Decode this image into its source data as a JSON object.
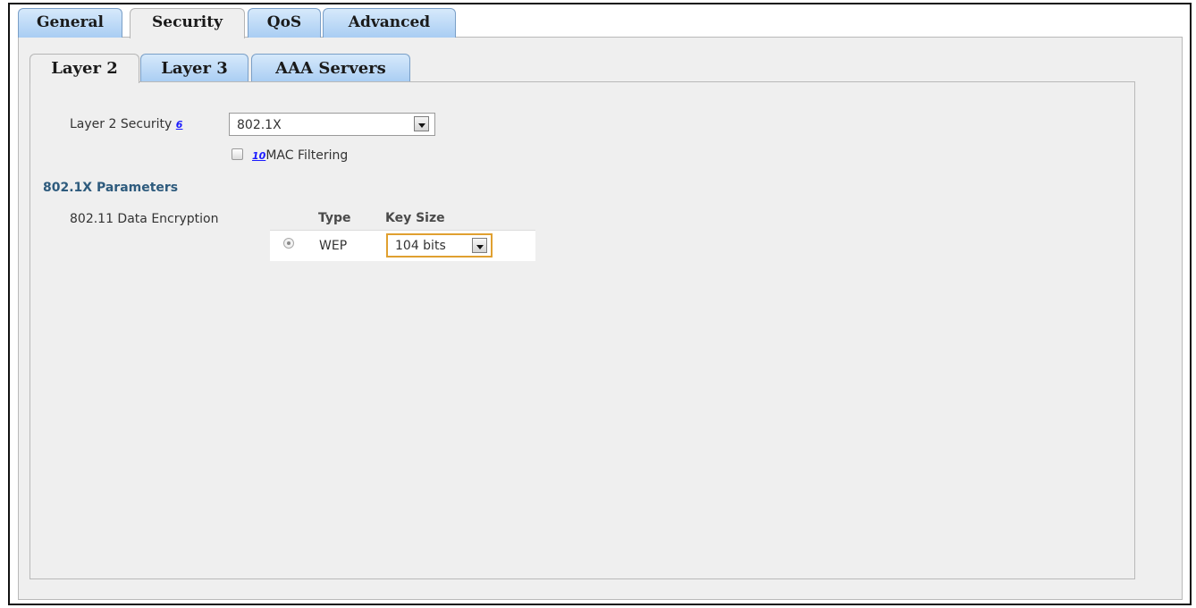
{
  "top_tabs": [
    {
      "label": "General",
      "active": false
    },
    {
      "label": "Security",
      "active": true
    },
    {
      "label": "QoS",
      "active": false
    },
    {
      "label": "Advanced",
      "active": false
    }
  ],
  "sub_tabs": [
    {
      "label": "Layer 2",
      "active": true
    },
    {
      "label": "Layer 3",
      "active": false
    },
    {
      "label": "AAA Servers",
      "active": false
    }
  ],
  "layer2_security": {
    "label": "Layer 2 Security",
    "help_ref": "6",
    "selected_value": "802.1X"
  },
  "mac_filtering": {
    "help_ref": "10",
    "label": "MAC Filtering",
    "checked": false
  },
  "parameters": {
    "section_title": "802.1X Parameters",
    "encryption_label": "802.11 Data Encryption",
    "table_headers": {
      "type": "Type",
      "key_size": "Key Size"
    },
    "row": {
      "type": "WEP",
      "key_size": "104 bits",
      "selected": true
    }
  },
  "colors": {
    "tab_gradient_top": "#d6e9fb",
    "tab_gradient_bottom": "#a9cdf3",
    "section_title": "#2e5b7d",
    "panel_background": "#efefef",
    "help_link": "#1a1aff",
    "focus_border": "#e0a030"
  },
  "icons": {
    "dropdown": "chevron-down-icon",
    "radio": "radio-selected-icon",
    "checkbox": "checkbox-unchecked-icon"
  }
}
